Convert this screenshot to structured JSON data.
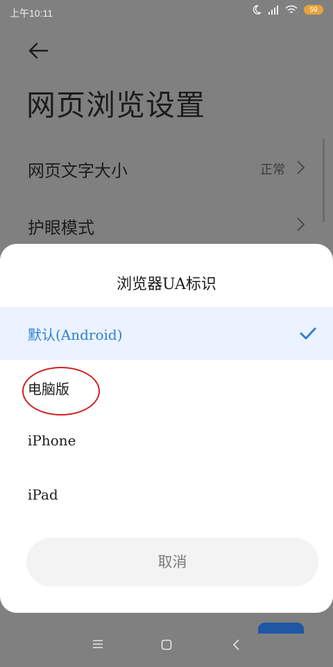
{
  "status_bar": {
    "time": "上午10:11",
    "battery": "59",
    "icons": [
      "moon-icon",
      "signal-icon",
      "wifi-icon",
      "battery-icon"
    ],
    "battery_color": "#e7a33c"
  },
  "settings_page": {
    "title": "网页浏览设置",
    "rows": [
      {
        "label": "网页文字大小",
        "value": "正常"
      },
      {
        "label": "护眼模式",
        "value": ""
      }
    ]
  },
  "ua_sheet": {
    "title": "浏览器UA标识",
    "options": [
      {
        "label": "默认(Android)",
        "selected": true
      },
      {
        "label": "电脑版",
        "selected": false
      },
      {
        "label": "iPhone",
        "selected": false
      },
      {
        "label": "iPad",
        "selected": false
      }
    ],
    "selected_color": "#2f7fd0",
    "cancel_label": "取消"
  },
  "nav_bar": {
    "icons": [
      "menu-icon",
      "home-icon",
      "back-icon"
    ]
  }
}
